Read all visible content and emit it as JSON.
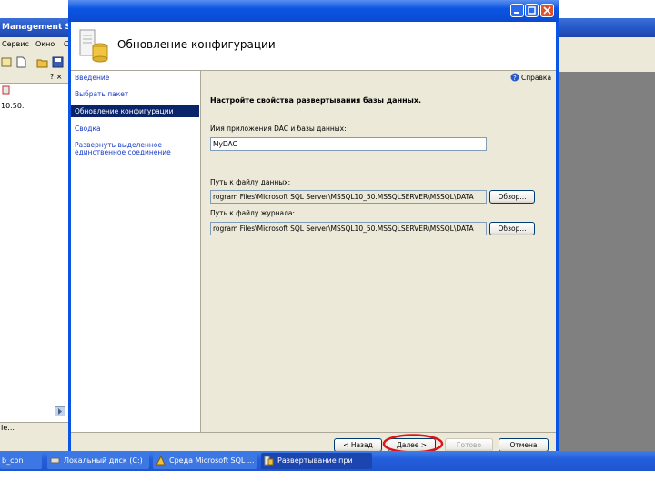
{
  "background_app": {
    "title": "Management Studi",
    "menu": [
      "Сервис",
      "Окно",
      "С"
    ],
    "panel_header": "? ×",
    "panel_items": [
      "10.50."
    ],
    "panel_bottom": "Ie..."
  },
  "taskbar": {
    "items": [
      {
        "label": "b_con"
      },
      {
        "label": "Локальный диск (C:)"
      },
      {
        "label": "Среда Microsoft SQL ..."
      },
      {
        "label": "Развертывание при"
      }
    ]
  },
  "dialog": {
    "header_title": "Обновление конфигурации",
    "help_label": "Справка",
    "nav_items": [
      {
        "label": "Введение"
      },
      {
        "label": "Выбрать пакет"
      },
      {
        "label": "Обновление конфигурации"
      },
      {
        "label": "Сводка"
      },
      {
        "label": "Развернуть выделенное единственное соединение"
      }
    ],
    "section_title": "Настройте свойства развертывания базы данных.",
    "dac_name_label": "Имя приложения DAC и базы данных:",
    "dac_name_value": "MyDAC",
    "data_path_label": "Путь к файлу данных:",
    "data_path_value": "rogram Files\\Microsoft SQL Server\\MSSQL10_50.MSSQLSERVER\\MSSQL\\DATA",
    "log_path_label": "Путь к файлу журнала:",
    "log_path_value": "rogram Files\\Microsoft SQL Server\\MSSQL10_50.MSSQLSERVER\\MSSQL\\DATA",
    "browse_label": "Обзор...",
    "buttons": {
      "back": "< Назад",
      "next": "Далее >",
      "finish": "Готово",
      "cancel": "Отмена"
    }
  },
  "colors": {
    "xp_blue": "#0a55e3",
    "selection": "#0a246a",
    "highlight_circle": "#d9141b"
  }
}
